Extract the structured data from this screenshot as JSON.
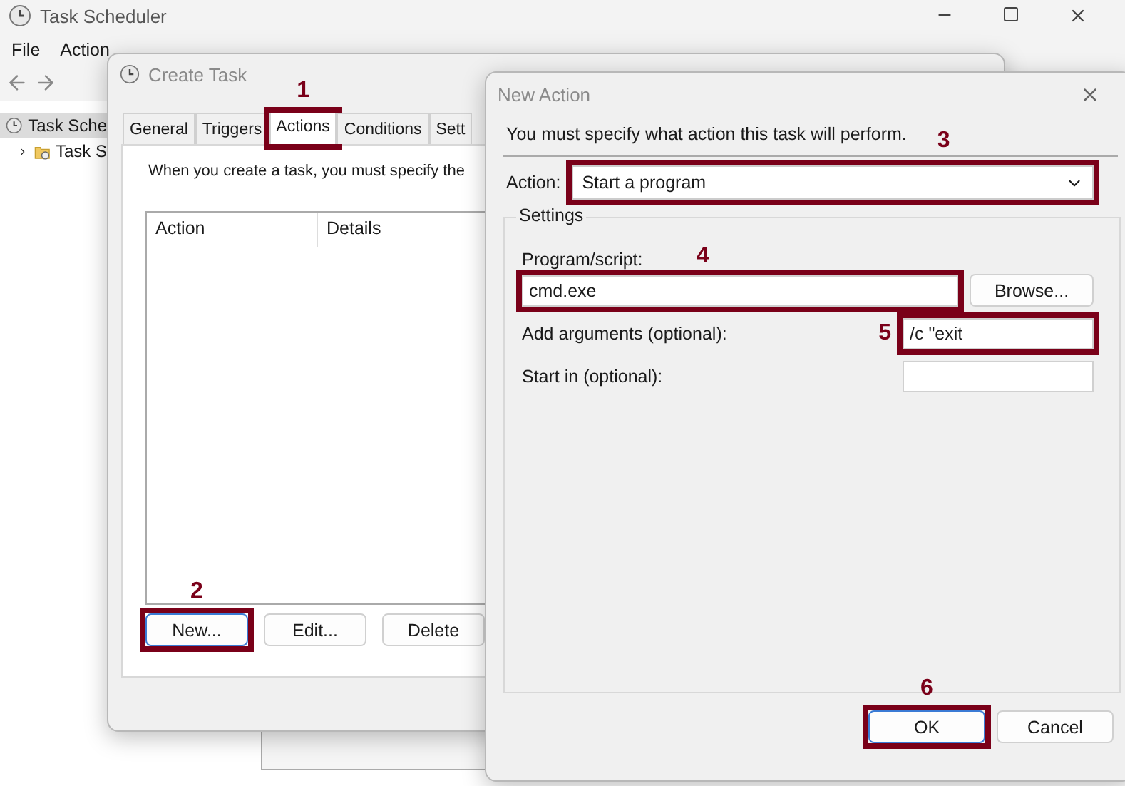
{
  "main_window": {
    "title": "Task Scheduler",
    "menu": [
      {
        "label": "File"
      },
      {
        "label": "Action"
      }
    ],
    "tree": [
      {
        "label": "Task Sche",
        "selected": true,
        "children": [
          {
            "label": "Task S",
            "selected": false,
            "expanded": false
          }
        ]
      }
    ]
  },
  "create_task": {
    "title": "Create Task",
    "tabs": [
      {
        "label": "General",
        "selected": false
      },
      {
        "label": "Triggers",
        "selected": false
      },
      {
        "label": "Actions",
        "selected": true,
        "callout": "1"
      },
      {
        "label": "Conditions",
        "selected": false
      },
      {
        "label": "Sett",
        "selected": false
      }
    ],
    "description": "When you create a task, you must specify the",
    "table": {
      "columns": [
        "Action",
        "Details"
      ]
    },
    "buttons": [
      {
        "label": "New...",
        "callout": "2"
      },
      {
        "label": "Edit..."
      },
      {
        "label": "Delete"
      }
    ]
  },
  "new_action": {
    "title": "New Action",
    "instruction": "You must specify what action this task will perform.",
    "action_label": "Action:",
    "action_value": "Start a program",
    "action_callout": "3",
    "settings_label": "Settings",
    "fields": [
      {
        "kind": "stacked",
        "label": "Program/script:",
        "value": "cmd.exe",
        "button": "Browse...",
        "callout": "4"
      },
      {
        "kind": "inline",
        "label": "Add arguments (optional):",
        "value": "/c \"exit",
        "callout": "5"
      },
      {
        "kind": "inline",
        "label": "Start in (optional):"
      }
    ],
    "buttons": [
      {
        "label": "OK",
        "default": true,
        "callout": "6"
      },
      {
        "label": "Cancel",
        "default": false
      }
    ]
  }
}
